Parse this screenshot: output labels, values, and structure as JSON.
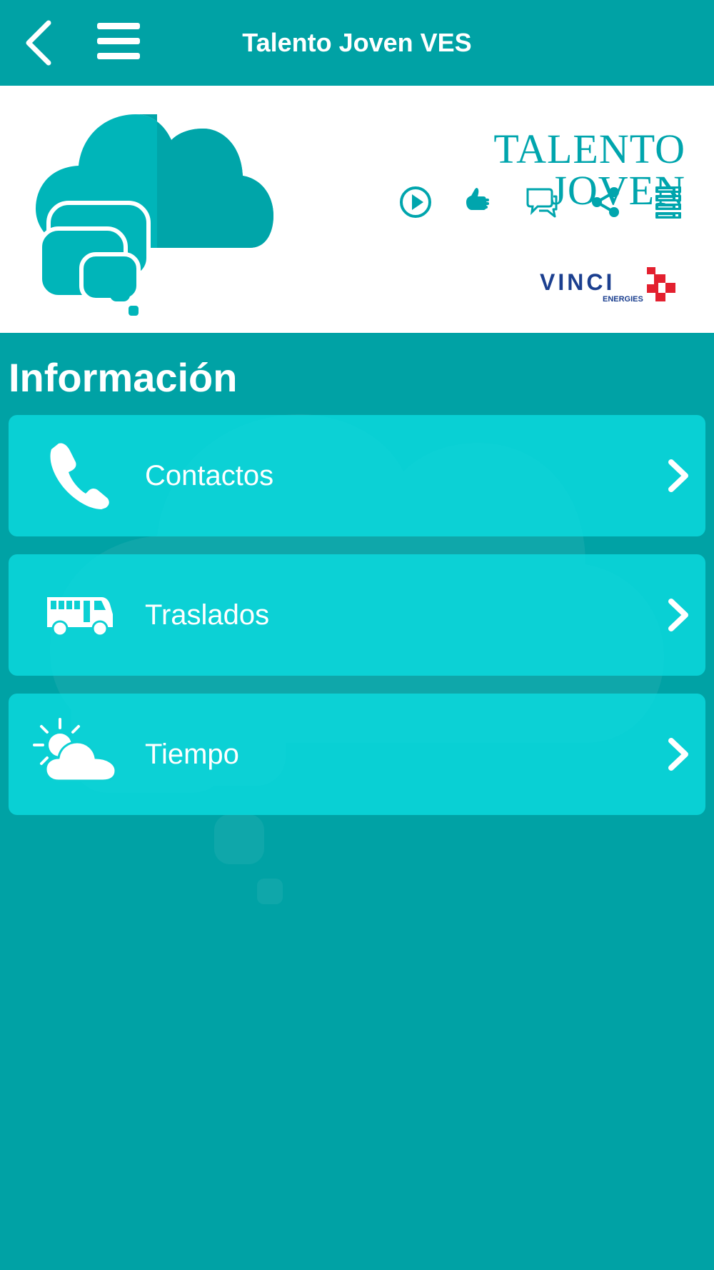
{
  "header": {
    "title": "Talento Joven VES",
    "back_icon": "back-arrow-icon",
    "menu_icon": "hamburger-menu-icon"
  },
  "banner": {
    "brand": "TALENTO JOVEN",
    "social_icons": [
      "play-icon",
      "thumbs-up-icon",
      "chat-icon",
      "share-icon",
      "list-icon"
    ],
    "partner_logo": {
      "name": "VINCI",
      "sub": "ENERGIES"
    }
  },
  "section": {
    "title": "Información"
  },
  "items": [
    {
      "label": "Contactos",
      "icon": "phone-icon"
    },
    {
      "label": "Traslados",
      "icon": "bus-icon"
    },
    {
      "label": "Tiempo",
      "icon": "weather-icon"
    }
  ],
  "colors": {
    "primary": "#00a2a5",
    "card": "#0cd0d3",
    "brand": "#00a5ad",
    "vinci_blue": "#1b3f8f",
    "vinci_red": "#e3202f"
  }
}
